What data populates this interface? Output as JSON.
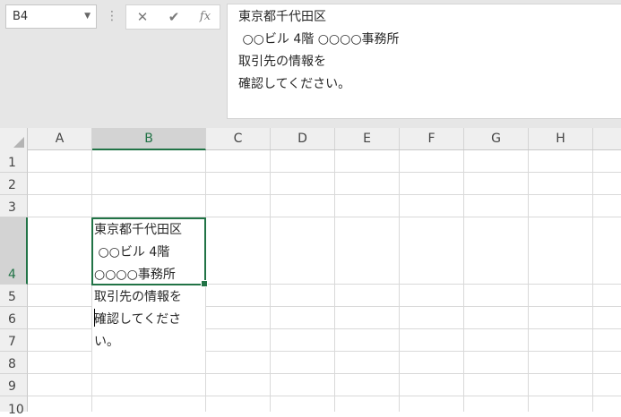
{
  "name_box": {
    "value": "B4"
  },
  "formula_bar": {
    "cancel_glyph": "✕",
    "enter_glyph": "✔",
    "fx_label": "fx",
    "lines": [
      "東京都千代田区",
      " ○○ビル 4階 ○○○○事務所",
      "取引先の情報を",
      "確認してください。"
    ]
  },
  "columns": [
    "A",
    "B",
    "C",
    "D",
    "E",
    "F",
    "G",
    "H"
  ],
  "rows": [
    "1",
    "2",
    "3",
    "4",
    "5",
    "6",
    "7",
    "8",
    "9",
    "10"
  ],
  "active_cell": {
    "column": "B",
    "row": "4"
  },
  "cell_b4": {
    "lines": [
      "東京都千代田区",
      " ○○ビル 4階",
      "○○○○事務所",
      "取引先の情報を",
      "確認してくださ",
      "い。"
    ]
  },
  "colors": {
    "accent": "#217346",
    "header_bg": "#efefef",
    "active_header_bg": "#d3d3d3"
  }
}
